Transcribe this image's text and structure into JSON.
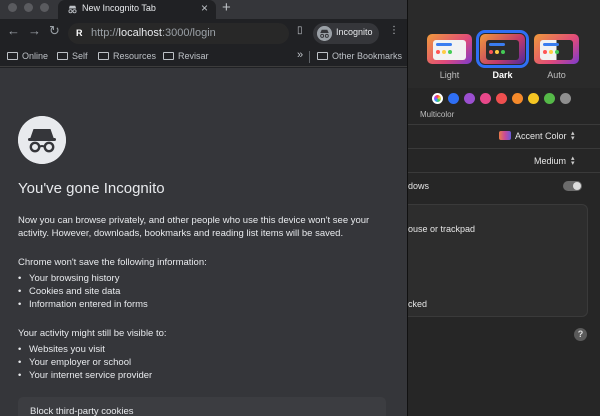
{
  "browser": {
    "tab_title": "New Incognito Tab",
    "new_tab_glyph": "+",
    "close_glyph": "×",
    "url_scheme": "http://",
    "url_host": "localhost",
    "url_rest": ":3000/login",
    "site_badge": "R",
    "profile_label": "Incognito",
    "bookmarks": [
      "Online",
      "Self",
      "Resources",
      "Revisar"
    ],
    "bookmarks_overflow": "»",
    "other_bookmarks": "Other Bookmarks",
    "icons": {
      "back": "arrow-left-icon",
      "forward": "arrow-right-icon",
      "reload": "reload-icon",
      "sidepanel": "side-panel-icon",
      "menu": "kebab-menu-icon",
      "folder": "folder-icon"
    }
  },
  "incognito_page": {
    "heading": "You've gone Incognito",
    "intro": "Now you can browse privately, and other people who use this device won't see your activity. However, downloads, bookmarks and reading list items will be saved.",
    "wont_save_title": "Chrome won't save the following information:",
    "wont_save": [
      "Your browsing history",
      "Cookies and site data",
      "Information entered in forms"
    ],
    "visible_title": "Your activity might still be visible to:",
    "visible": [
      "Websites you visit",
      "Your employer or school",
      "Your internet service provider"
    ],
    "cookie_box": "Block third-party cookies"
  },
  "settings": {
    "themes": [
      "Light",
      "Dark",
      "Auto"
    ],
    "selected_theme": "Dark",
    "swatch_colors": [
      "#2f6ff5",
      "#9b4fd0",
      "#e8488a",
      "#ef4f4f",
      "#f58a2b",
      "#f5c623",
      "#55b948",
      "#8e8e8e"
    ],
    "multicolor_label": "Multicolor",
    "accent_label": "Accent Color",
    "size_value": "Medium",
    "row_windows": "dows",
    "row_mouse": "ouse or trackpad",
    "row_locked": "cked",
    "help_glyph": "?"
  }
}
